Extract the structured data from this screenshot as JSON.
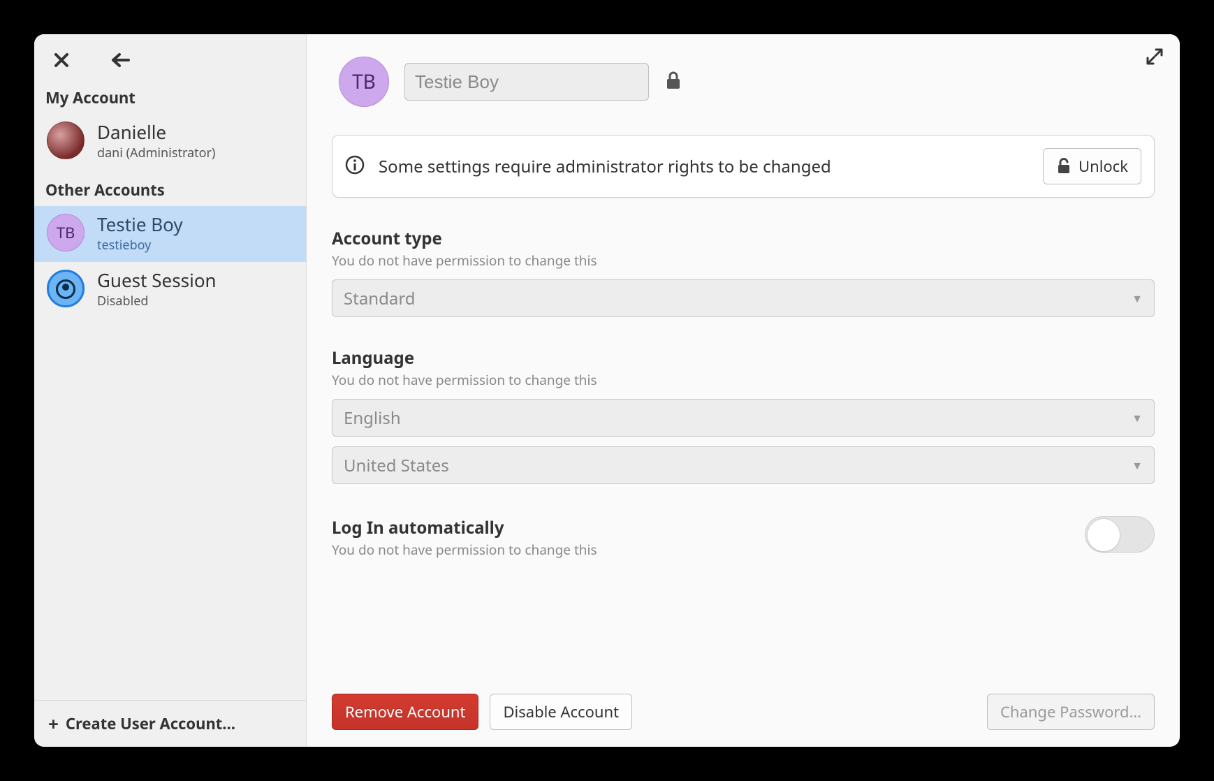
{
  "sidebar": {
    "my_account_label": "My Account",
    "other_accounts_label": "Other Accounts",
    "accounts": {
      "mine": {
        "name": "Danielle",
        "sub": "dani (Administrator)"
      },
      "selected": {
        "name": "Testie Boy",
        "sub": "testieboy",
        "initials": "TB"
      },
      "guest": {
        "name": "Guest Session",
        "sub": "Disabled"
      }
    },
    "create_label": "Create User Account…"
  },
  "header": {
    "initials": "TB",
    "name_value": "Testie Boy"
  },
  "infobar": {
    "text": "Some settings require administrator rights to be changed",
    "unlock_label": "Unlock"
  },
  "fields": {
    "account_type": {
      "label": "Account type",
      "note": "You do not have permission to change this",
      "value": "Standard"
    },
    "language": {
      "label": "Language",
      "note": "You do not have permission to change this",
      "lang_value": "English",
      "region_value": "United States"
    },
    "autologin": {
      "label": "Log In automatically",
      "note": "You do not have permission to change this"
    }
  },
  "footer": {
    "remove_label": "Remove Account",
    "disable_label": "Disable Account",
    "change_pw_label": "Change Password…"
  }
}
